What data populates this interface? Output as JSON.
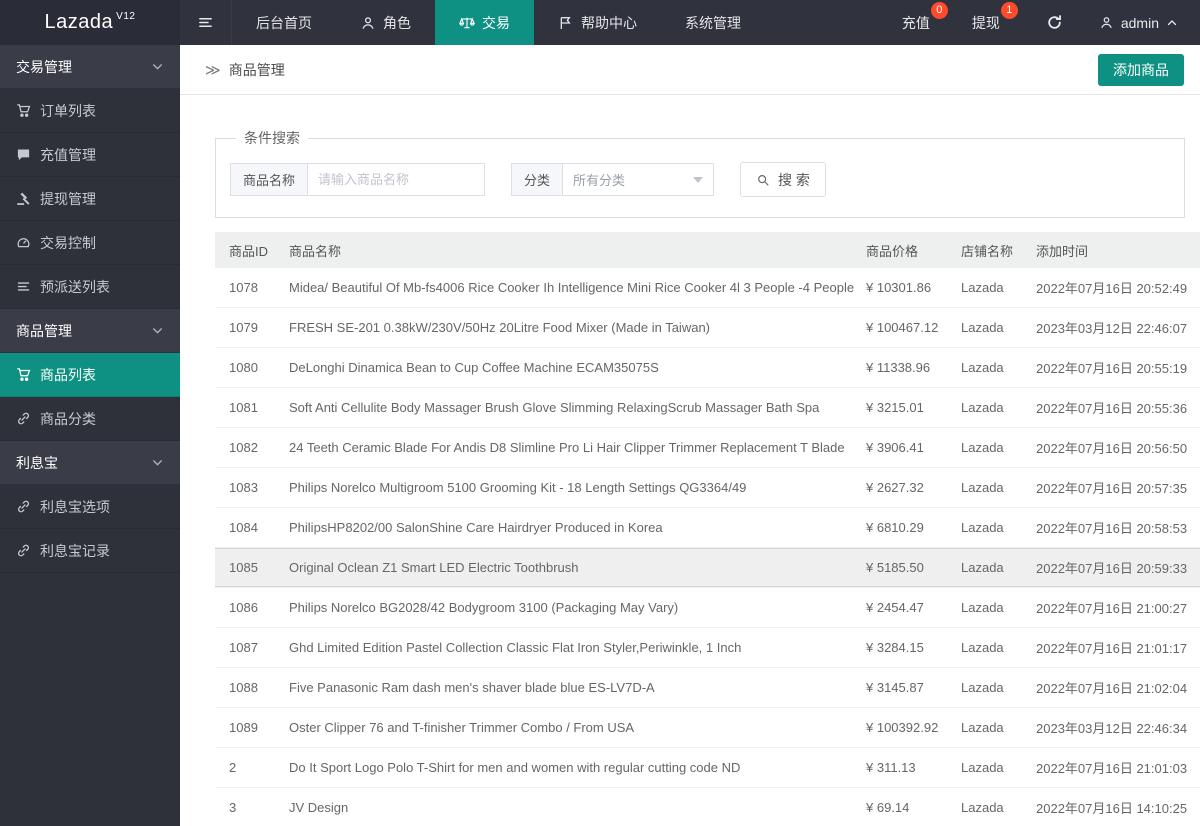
{
  "brand": {
    "name": "Lazada",
    "version": "V12"
  },
  "colors": {
    "accent": "#0e9182",
    "badge": "#ff4a2c",
    "nav_bg": "#30323e",
    "logo_bg": "#2a2c38",
    "side_bg": "#2e313a",
    "side_group_bg": "#3a3d48"
  },
  "topnav": {
    "items": [
      {
        "key": "home",
        "label": "后台首页",
        "icon": null,
        "active": false
      },
      {
        "key": "roles",
        "label": "角色",
        "icon": "user",
        "active": false
      },
      {
        "key": "trade",
        "label": "交易",
        "icon": "scales",
        "active": true
      },
      {
        "key": "help-center",
        "label": "帮助中心",
        "icon": "flag",
        "active": false
      },
      {
        "key": "system",
        "label": "系统管理",
        "icon": null,
        "active": false
      }
    ],
    "right": {
      "recharge": {
        "label": "充值",
        "badge": "0"
      },
      "withdraw": {
        "label": "提现",
        "badge": "1"
      },
      "user": "admin"
    }
  },
  "sidebar": {
    "groups": [
      {
        "key": "trade-management",
        "label": "交易管理",
        "items": [
          {
            "key": "order-list",
            "label": "订单列表",
            "icon": "cart",
            "active": false
          },
          {
            "key": "recharge-management",
            "label": "充值管理",
            "icon": "comment",
            "active": false
          },
          {
            "key": "withdraw-management",
            "label": "提现管理",
            "icon": "gavel",
            "active": false
          },
          {
            "key": "trade-control",
            "label": "交易控制",
            "icon": "dashboard",
            "active": false
          },
          {
            "key": "predelivery-list",
            "label": "预派送列表",
            "icon": "list",
            "active": false
          }
        ]
      },
      {
        "key": "product-management",
        "label": "商品管理",
        "items": [
          {
            "key": "product-list",
            "label": "商品列表",
            "icon": "cart",
            "active": true
          },
          {
            "key": "product-category",
            "label": "商品分类",
            "icon": "link",
            "active": false
          }
        ]
      },
      {
        "key": "interest-treasure",
        "label": "利息宝",
        "items": [
          {
            "key": "interest-options",
            "label": "利息宝选项",
            "icon": "link",
            "active": false
          },
          {
            "key": "interest-records",
            "label": "利息宝记录",
            "icon": "link",
            "active": false
          }
        ]
      }
    ]
  },
  "page": {
    "breadcrumb_icon": "≫",
    "breadcrumb": "商品管理",
    "add_button": "添加商品"
  },
  "search": {
    "legend": "条件搜索",
    "name_label": "商品名称",
    "name_placeholder": "请输入商品名称",
    "name_value": "",
    "category_label": "分类",
    "category_value": "所有分类",
    "search_button": "搜 索"
  },
  "table": {
    "columns": [
      "商品ID",
      "商品名称",
      "商品价格",
      "店铺名称",
      "添加时间"
    ],
    "highlighted_index": 7,
    "rows": [
      [
        "1078",
        "Midea/ Beautiful Of Mb-fs4006 Rice Cooker Ih Intelligence Mini Rice Cooker 4l 3 People -4 People",
        "¥ 10301.86",
        "Lazada",
        "2022年07月16日 20:52:49"
      ],
      [
        "1079",
        "FRESH SE-201 0.38kW/230V/50Hz 20Litre Food Mixer (Made in Taiwan)",
        "¥ 100467.12",
        "Lazada",
        "2023年03月12日 22:46:07"
      ],
      [
        "1080",
        "DeLonghi Dinamica Bean to Cup Coffee Machine ECAM35075S",
        "¥ 11338.96",
        "Lazada",
        "2022年07月16日 20:55:19"
      ],
      [
        "1081",
        "Soft Anti Cellulite Body Massager Brush Glove Slimming RelaxingScrub Massager Bath Spa",
        "¥ 3215.01",
        "Lazada",
        "2022年07月16日 20:55:36"
      ],
      [
        "1082",
        "24 Teeth Ceramic Blade For Andis D8 Slimline Pro Li Hair Clipper Trimmer Replacement T Blade",
        "¥ 3906.41",
        "Lazada",
        "2022年07月16日 20:56:50"
      ],
      [
        "1083",
        "Philips Norelco Multigroom 5100 Grooming Kit - 18 Length Settings QG3364/49",
        "¥ 2627.32",
        "Lazada",
        "2022年07月16日 20:57:35"
      ],
      [
        "1084",
        "PhilipsHP8202/00 SalonShine Care Hairdryer Produced in Korea",
        "¥ 6810.29",
        "Lazada",
        "2022年07月16日 20:58:53"
      ],
      [
        "1085",
        "Original Oclean Z1 Smart LED Electric Toothbrush",
        "¥ 5185.50",
        "Lazada",
        "2022年07月16日 20:59:33"
      ],
      [
        "1086",
        "Philips Norelco BG2028/42 Bodygroom 3100 (Packaging May Vary)",
        "¥ 2454.47",
        "Lazada",
        "2022年07月16日 21:00:27"
      ],
      [
        "1087",
        "Ghd Limited Edition Pastel Collection Classic Flat Iron Styler,Periwinkle, 1 Inch",
        "¥ 3284.15",
        "Lazada",
        "2022年07月16日 21:01:17"
      ],
      [
        "1088",
        "Five Panasonic Ram dash men's shaver blade blue ES-LV7D-A",
        "¥ 3145.87",
        "Lazada",
        "2022年07月16日 21:02:04"
      ],
      [
        "1089",
        "Oster Clipper 76 and T-finisher Trimmer Combo / From USA",
        "¥ 100392.92",
        "Lazada",
        "2023年03月12日 22:46:34"
      ],
      [
        "2",
        "Do It Sport Logo Polo T-Shirt for men and women with regular cutting code ND",
        "¥ 311.13",
        "Lazada",
        "2022年07月16日 21:01:03"
      ],
      [
        "3",
        "JV Design",
        "¥ 69.14",
        "Lazada",
        "2022年07月16日 14:10:25"
      ]
    ]
  }
}
